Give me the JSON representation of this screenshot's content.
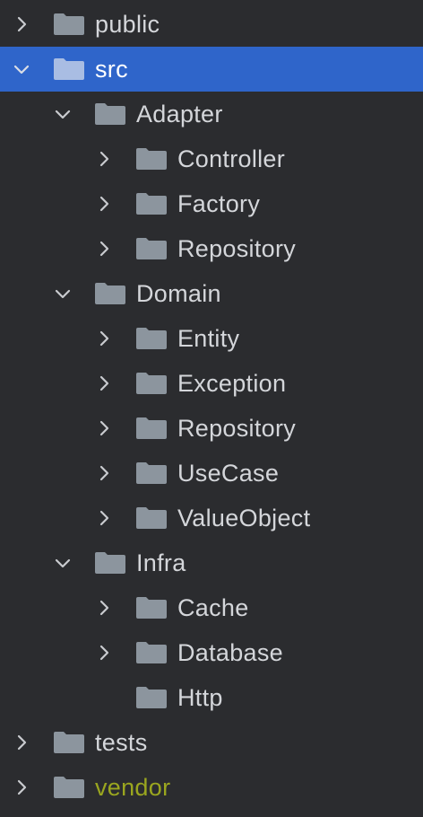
{
  "colors": {
    "background": "#2b2c2f",
    "selection": "#2f65ca",
    "text": "#d4d6da",
    "folder": "#8c959e",
    "folder_selected": "#a9bde3",
    "library_text": "#9aa61f"
  },
  "tree": {
    "items": [
      {
        "label": "public",
        "icon": "folder-icon",
        "expander": "chevron-right-icon"
      },
      {
        "label": "src",
        "icon": "folder-icon",
        "expander": "chevron-down-icon",
        "selected": true
      },
      {
        "label": "Adapter",
        "icon": "folder-icon",
        "expander": "chevron-down-icon"
      },
      {
        "label": "Controller",
        "icon": "folder-icon",
        "expander": "chevron-right-icon"
      },
      {
        "label": "Factory",
        "icon": "folder-icon",
        "expander": "chevron-right-icon"
      },
      {
        "label": "Repository",
        "icon": "folder-icon",
        "expander": "chevron-right-icon"
      },
      {
        "label": "Domain",
        "icon": "folder-icon",
        "expander": "chevron-down-icon"
      },
      {
        "label": "Entity",
        "icon": "folder-icon",
        "expander": "chevron-right-icon"
      },
      {
        "label": "Exception",
        "icon": "folder-icon",
        "expander": "chevron-right-icon"
      },
      {
        "label": "Repository",
        "icon": "folder-icon",
        "expander": "chevron-right-icon"
      },
      {
        "label": "UseCase",
        "icon": "folder-icon",
        "expander": "chevron-right-icon"
      },
      {
        "label": "ValueObject",
        "icon": "folder-icon",
        "expander": "chevron-right-icon"
      },
      {
        "label": "Infra",
        "icon": "folder-icon",
        "expander": "chevron-down-icon"
      },
      {
        "label": "Cache",
        "icon": "folder-icon",
        "expander": "chevron-right-icon"
      },
      {
        "label": "Database",
        "icon": "folder-icon",
        "expander": "chevron-right-icon"
      },
      {
        "label": "Http",
        "icon": "folder-icon",
        "expander": "none"
      },
      {
        "label": "tests",
        "icon": "folder-icon",
        "expander": "chevron-right-icon"
      },
      {
        "label": "vendor",
        "icon": "folder-icon",
        "expander": "chevron-right-icon",
        "library": true
      }
    ]
  }
}
